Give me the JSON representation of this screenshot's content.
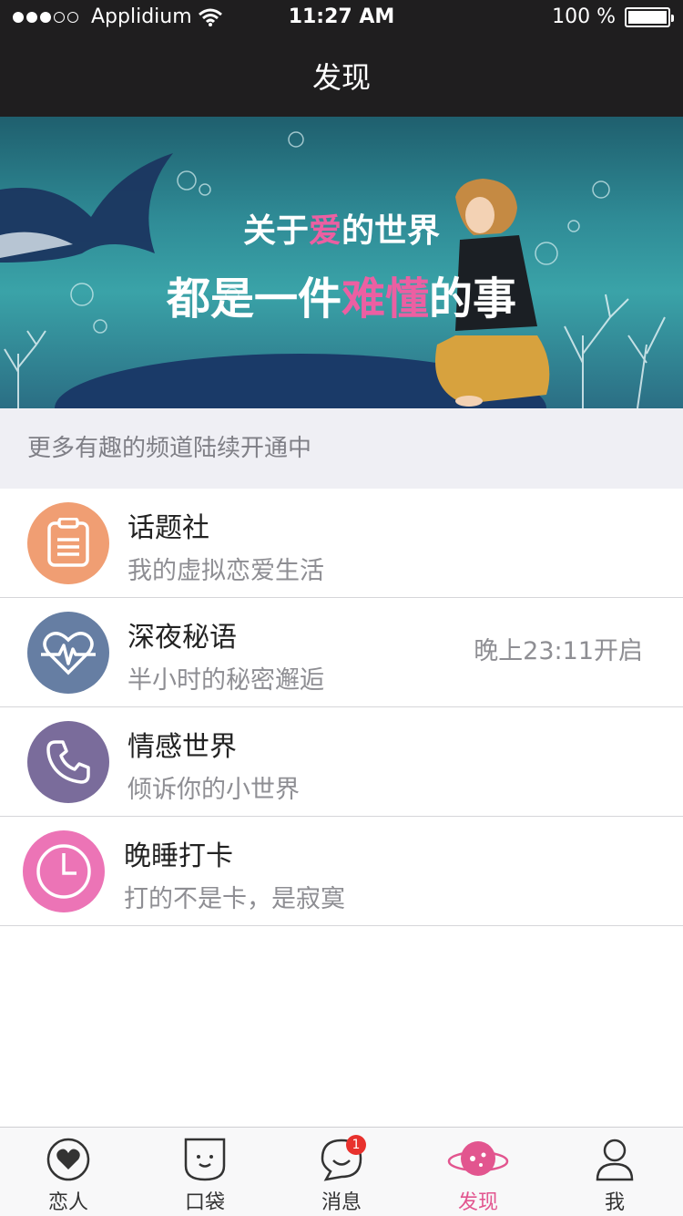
{
  "status_bar": {
    "carrier": "Applidium",
    "time": "11:27 AM",
    "battery": "100 %",
    "signal_bars_filled": 3,
    "signal_bars_total": 5
  },
  "nav": {
    "title": "发现"
  },
  "banner": {
    "line1_pre": "关于",
    "line1_highlight": "爱",
    "line1_post": "的世界",
    "line2_pre": "都是一件",
    "line2_highlight": "难懂",
    "line2_post": "的事",
    "highlight_color": "#ec5fa2"
  },
  "section": {
    "header": "更多有趣的频道陆续开通中"
  },
  "channels": [
    {
      "title": "话题社",
      "subtitle": "我的虚拟恋爱生活",
      "aside": "",
      "icon": "clipboard-icon",
      "color": "#f09e73"
    },
    {
      "title": "深夜秘语",
      "subtitle": "半小时的秘密邂逅",
      "aside": "晚上23:11开启",
      "icon": "heartbeat-icon",
      "color": "#667ea3"
    },
    {
      "title": "情感世界",
      "subtitle": "倾诉你的小世界",
      "aside": "",
      "icon": "phone-icon",
      "color": "#7a6c9b"
    },
    {
      "title": "晚睡打卡",
      "subtitle": "打的不是卡，是寂寞",
      "aside": "",
      "icon": "clock-icon",
      "color": "#ec74b6"
    }
  ],
  "tabbar": {
    "tabs": [
      {
        "label": "恋人",
        "icon": "heart-icon"
      },
      {
        "label": "口袋",
        "icon": "pocket-icon"
      },
      {
        "label": "消息",
        "icon": "chat-icon",
        "badge": "1"
      },
      {
        "label": "发现",
        "icon": "planet-icon",
        "active": true
      },
      {
        "label": "我",
        "icon": "user-icon"
      }
    ],
    "active_color": "#e2558f"
  }
}
